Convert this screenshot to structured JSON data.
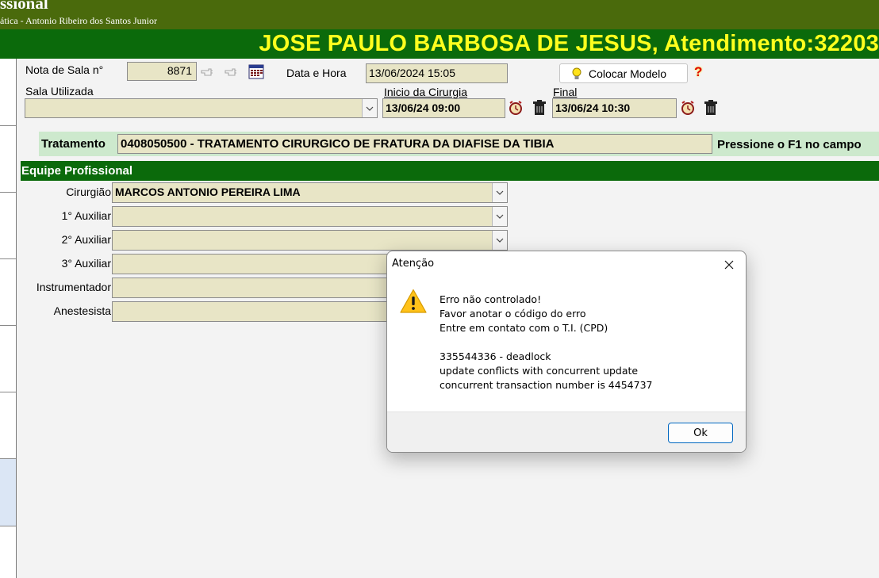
{
  "app": {
    "title_fragment": "ssional",
    "subtitle": "ática - Antonio Ribeiro dos Santos Junior"
  },
  "patient_bar": {
    "text": "JOSE PAULO BARBOSA DE JESUS, Atendimento:32203"
  },
  "form": {
    "nota_label": "Nota de Sala n°",
    "nota_value": "8871",
    "data_hora_label": "Data e Hora",
    "data_hora_value": "13/06/2024 15:05",
    "colocar_modelo_label": "Colocar Modelo",
    "sala_label": "Sala Utilizada",
    "sala_value": "",
    "inicio_label": "Inicio da Cirurgia",
    "inicio_value": "13/06/24 09:00",
    "final_label": "Final",
    "final_value": "13/06/24 10:30"
  },
  "tratamento": {
    "label": "Tratamento",
    "value": "0408050500 - TRATAMENTO CIRURGICO DE FRATURA DA DIAFISE DA TIBIA",
    "hint": "Pressione o F1 no campo"
  },
  "equipe": {
    "title": "Equipe Profissional",
    "rows": [
      {
        "label": "Cirurgião",
        "value": "MARCOS ANTONIO PEREIRA LIMA"
      },
      {
        "label": "1° Auxiliar",
        "value": ""
      },
      {
        "label": "2° Auxiliar",
        "value": ""
      },
      {
        "label": "3° Auxiliar",
        "value": ""
      },
      {
        "label": "Instrumentador",
        "value": ""
      },
      {
        "label": "Anestesista",
        "value": ""
      }
    ]
  },
  "dialog": {
    "title": "Atenção",
    "lines": [
      "Erro não controlado!",
      "Favor anotar o código do erro",
      "Entre em contato com o T.I. (CPD)",
      "",
      "335544336 - deadlock",
      "update conflicts with concurrent update",
      "concurrent transaction number is 4454737"
    ],
    "ok_label": "Ok"
  },
  "icons": [
    "help-icon",
    "bulb-icon",
    "calendar-icon",
    "alarm-clock-icon",
    "trash-icon",
    "chevron-down-icon",
    "close-icon",
    "warning-icon"
  ],
  "colors": {
    "topbar": "#4a6a0c",
    "patient_bar": "#0b6a0b",
    "patient_text": "#ffff1e",
    "field_bg": "#e8e5c6",
    "tratamento_bar": "#cde9cd"
  }
}
